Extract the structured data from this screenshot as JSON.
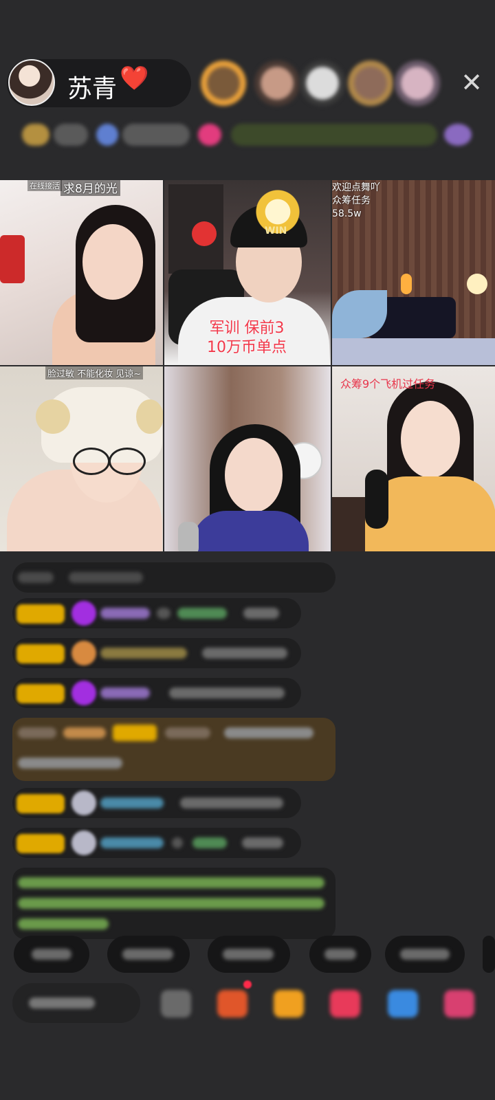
{
  "host": {
    "name": "苏青",
    "heart": "❤️"
  },
  "close_icon": "✕",
  "video_tiles": [
    {
      "label": "在线接活",
      "title": "求8月的光",
      "caption": ""
    },
    {
      "label": "",
      "title": "",
      "caption": "军训 保前3\n10万币单点",
      "sticker": "WIN"
    },
    {
      "label": "",
      "title": "欢迎点舞吖\n众筹任务\n58.5w",
      "caption": ""
    },
    {
      "label": "",
      "title": "脸过敏 不能化妆 见谅~",
      "caption": ""
    },
    {
      "label": "",
      "title": "",
      "caption": ""
    },
    {
      "label": "",
      "title": "众筹9个飞机过任务",
      "caption": ""
    }
  ],
  "colors": {
    "accent_red": "#f2384a",
    "badge_gold": "#e0a900",
    "bg": "#2a2a2c"
  }
}
